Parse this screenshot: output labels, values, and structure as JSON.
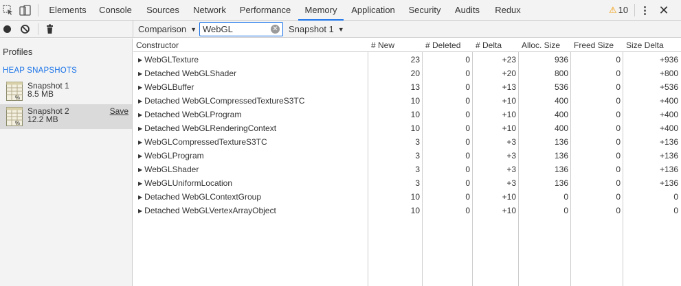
{
  "tabs": [
    {
      "label": "Elements",
      "active": false
    },
    {
      "label": "Console",
      "active": false
    },
    {
      "label": "Sources",
      "active": false
    },
    {
      "label": "Network",
      "active": false
    },
    {
      "label": "Performance",
      "active": false
    },
    {
      "label": "Memory",
      "active": true
    },
    {
      "label": "Application",
      "active": false
    },
    {
      "label": "Security",
      "active": false
    },
    {
      "label": "Audits",
      "active": false
    },
    {
      "label": "Redux",
      "active": false
    }
  ],
  "warnings": {
    "icon": "warning-triangle-icon",
    "count": "10"
  },
  "toolbar": {
    "view_select": "Comparison",
    "filter_value": "WebGL",
    "base_snapshot": "Snapshot 1"
  },
  "sidebar": {
    "title": "Profiles",
    "section": "HEAP SNAPSHOTS",
    "snapshots": [
      {
        "name": "Snapshot 1",
        "size": "8.5 MB",
        "selected": false,
        "action": ""
      },
      {
        "name": "Snapshot 2",
        "size": "12.2 MB",
        "selected": true,
        "action": "Save"
      }
    ]
  },
  "grid": {
    "columns": [
      "Constructor",
      "# New",
      "# Deleted",
      "# Delta",
      "Alloc. Size",
      "Freed Size",
      "Size Delta"
    ],
    "rows": [
      [
        "WebGLTexture",
        "23",
        "0",
        "+23",
        "936",
        "0",
        "+936"
      ],
      [
        "Detached WebGLShader",
        "20",
        "0",
        "+20",
        "800",
        "0",
        "+800"
      ],
      [
        "WebGLBuffer",
        "13",
        "0",
        "+13",
        "536",
        "0",
        "+536"
      ],
      [
        "Detached WebGLCompressedTextureS3TC",
        "10",
        "0",
        "+10",
        "400",
        "0",
        "+400"
      ],
      [
        "Detached WebGLProgram",
        "10",
        "0",
        "+10",
        "400",
        "0",
        "+400"
      ],
      [
        "Detached WebGLRenderingContext",
        "10",
        "0",
        "+10",
        "400",
        "0",
        "+400"
      ],
      [
        "WebGLCompressedTextureS3TC",
        "3",
        "0",
        "+3",
        "136",
        "0",
        "+136"
      ],
      [
        "WebGLProgram",
        "3",
        "0",
        "+3",
        "136",
        "0",
        "+136"
      ],
      [
        "WebGLShader",
        "3",
        "0",
        "+3",
        "136",
        "0",
        "+136"
      ],
      [
        "WebGLUniformLocation",
        "3",
        "0",
        "+3",
        "136",
        "0",
        "+136"
      ],
      [
        "Detached WebGLContextGroup",
        "10",
        "0",
        "+10",
        "0",
        "0",
        "0"
      ],
      [
        "Detached WebGLVertexArrayObject",
        "10",
        "0",
        "+10",
        "0",
        "0",
        "0"
      ]
    ]
  },
  "colors": {
    "accent": "#1a73e8",
    "warning": "#f29900",
    "panel_bg": "#f3f3f3",
    "selected_bg": "#dadada",
    "border": "#cccccc"
  }
}
